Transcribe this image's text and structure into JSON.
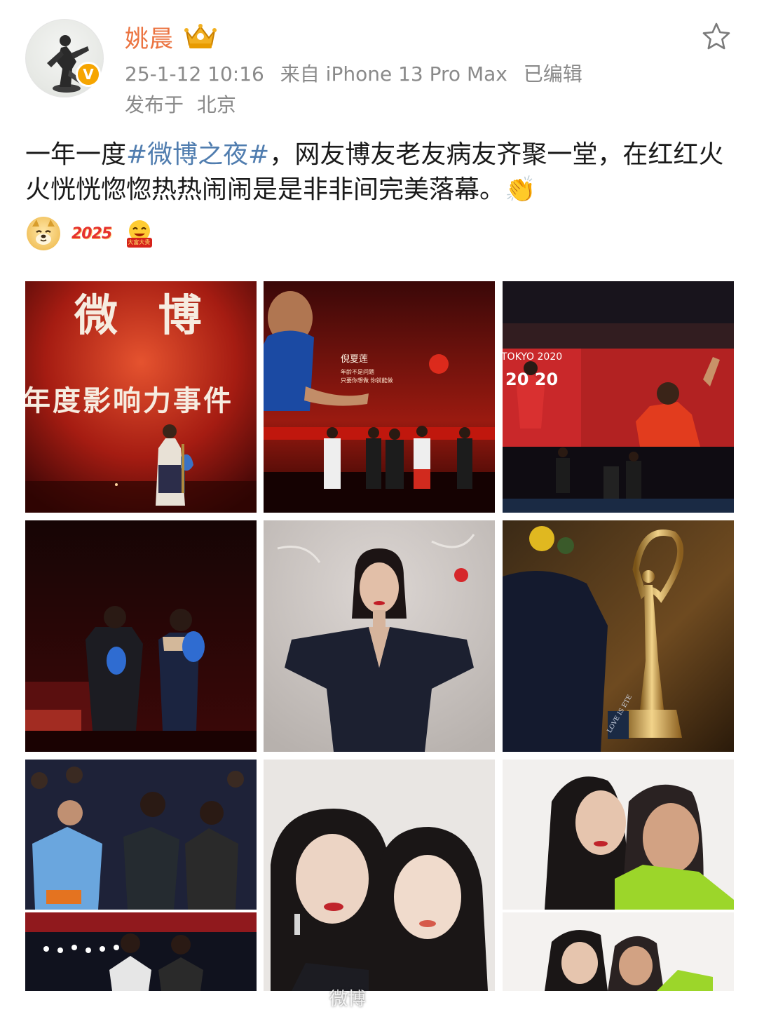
{
  "author": {
    "name": "姚晨",
    "verified_badge": "V"
  },
  "meta": {
    "timestamp": "25-1-12 10:16",
    "source": "来自 iPhone 13 Pro Max",
    "edited": "已编辑",
    "location_prefix": "发布于",
    "location": "北京"
  },
  "post": {
    "text_before": "一年一度",
    "hashtag": "#微博之夜#",
    "text_after": "，网友博友老友病友齐聚一堂，在红红火火恍恍惚惚热热闹闹是是非非间完美落幕。",
    "clap_emoji": "👏",
    "emoji_2025": "2025",
    "emoji_rich_label": "大富大贵"
  },
  "photos": {
    "p1_caption_top": "微 博",
    "p1_caption_bottom": "年度影响力事件",
    "p2_name": "倪夏莲",
    "p2_line1": "年龄不是问题",
    "p2_line2": "只要你想做 你就能做",
    "p3_screen_text": "TOKYO 2020",
    "p3_score": "20 20",
    "p6_ribbon": "LOVE IS ETE"
  },
  "watermark": "微博"
}
